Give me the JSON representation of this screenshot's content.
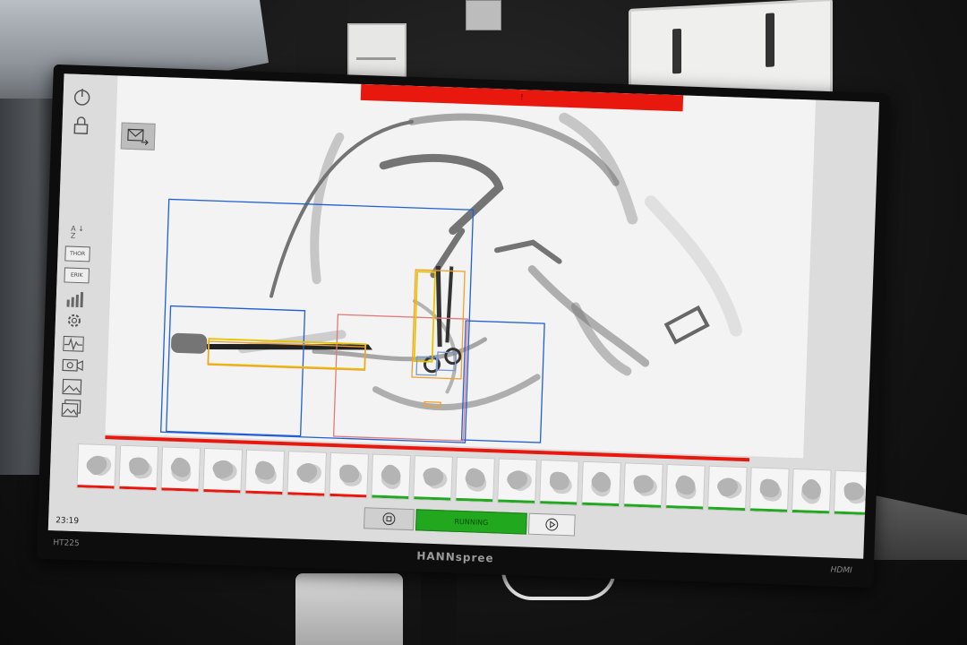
{
  "screen": {
    "clock": "23:19",
    "status_label": "RUNNING",
    "alarm_text": "!",
    "sidebar": {
      "az_label_a": "A",
      "az_label_z": "Z",
      "operators": [
        {
          "label": "THOR"
        },
        {
          "label": "ERIK"
        }
      ]
    },
    "thumbnails": [
      {
        "marker": "red"
      },
      {
        "marker": "red"
      },
      {
        "marker": "red"
      },
      {
        "marker": "red"
      },
      {
        "marker": "red"
      },
      {
        "marker": "red"
      },
      {
        "marker": "red"
      },
      {
        "marker": "green"
      },
      {
        "marker": "green"
      },
      {
        "marker": "green"
      },
      {
        "marker": "green"
      },
      {
        "marker": "green"
      },
      {
        "marker": "green"
      },
      {
        "marker": "green"
      },
      {
        "marker": "green"
      },
      {
        "marker": "green"
      },
      {
        "marker": "green"
      },
      {
        "marker": "green"
      },
      {
        "marker": "green"
      }
    ],
    "colors": {
      "alarm": "#e8180f",
      "status_ok": "#22a81e",
      "box_blue": "#1f5fd6",
      "box_orange": "#f0a030",
      "box_yellow": "#e6c400",
      "box_pink": "#e07a7a"
    }
  },
  "monitor": {
    "brand": "HANNspree",
    "model": "HT225",
    "port_label": "HDMI"
  }
}
